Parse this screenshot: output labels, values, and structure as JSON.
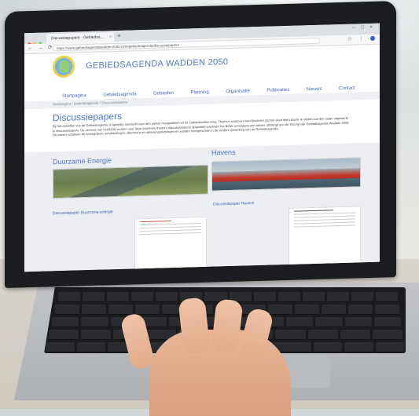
{
  "browser": {
    "tab_title": "Discussiepapers - Gebiedsa...",
    "tab_close": "×",
    "new_tab": "+",
    "window_buttons": "– □ ×",
    "nav_icons": "← → ⟳",
    "url": "https://www.gebiedsagendawadden2050.nl/nl/gebiedsagenda/discussiepapers",
    "toolbar_icons": "☆ ⋮"
  },
  "site": {
    "title": "GEBIEDSAGENDA WADDEN 2050",
    "menu": [
      "Startpagina",
      "Gebiedsagenda",
      "Gebieden",
      "Planning",
      "Organisatie",
      "Publicaties",
      "Nieuws",
      "Contact"
    ],
    "breadcrumb": "Startpagina  /  Gebiedsagenda  /  Discussiepapers"
  },
  "main": {
    "page_title": "Discussiepapers",
    "intro": "Bij het opstellen van de Gebiedsagenda is speciale aandacht voor een aantal vraagstukken uit de Gebiedsverkenning. Thema's waarover werd besloten dat het sloot dient plaats te vinden worden nader uitgewerkt in discussiepapers. Op verzoek van het BOW worden voor deze prioritaire thema's discussiepapers opgesteld waarover het BOW vervolgens een advies uitbrengt aan de Stuurgroep Gebiedsagenda Wadden 2050. De papers schetsen de belangrijkste ontwikkelingen, dilemma's en oplossingsrichtingen en worden meegenomen in de verdere uitwerking van de Gebiedsagenda."
  },
  "cards": [
    {
      "title": "Duurzame Energie",
      "link": "Discussiepaper Duurzame energie",
      "image": "solar-field-photo"
    },
    {
      "title": "Havens",
      "link": "Discussiepaper Havens",
      "image": "harbour-ships-photo"
    }
  ],
  "colors": {
    "brand_blue": "#4d78c6",
    "link_blue": "#3f5fbf",
    "traffic_red": "#ee6a5f",
    "traffic_yellow": "#f5be4f",
    "traffic_green": "#62c554"
  }
}
